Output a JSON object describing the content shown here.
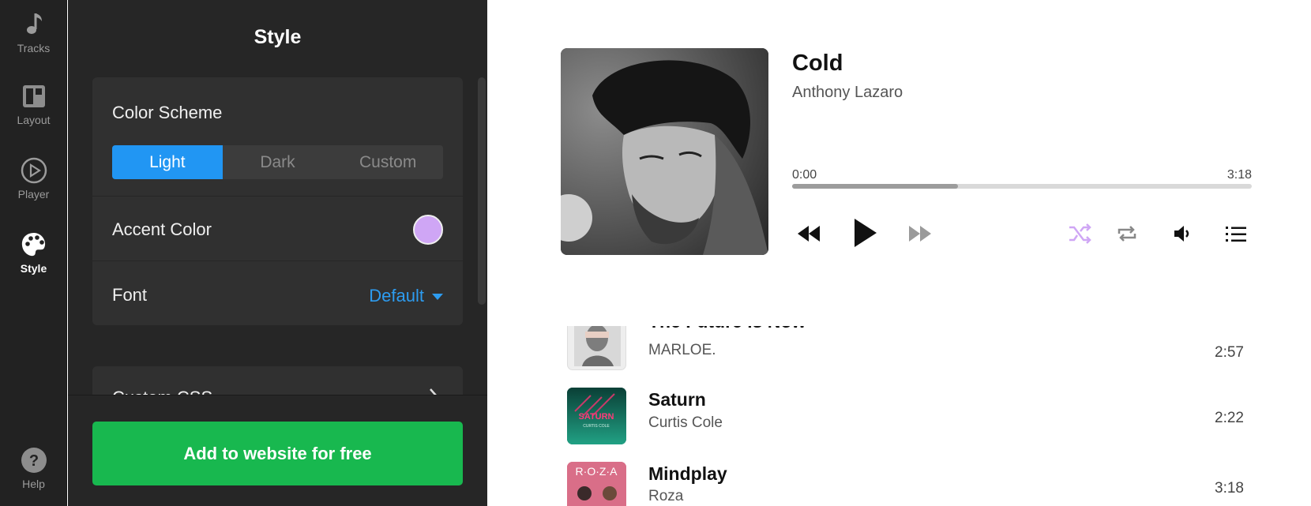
{
  "rail": {
    "items": [
      {
        "label": "Tracks",
        "icon": "music-note-icon"
      },
      {
        "label": "Layout",
        "icon": "layout-icon"
      },
      {
        "label": "Player",
        "icon": "play-circle-icon"
      },
      {
        "label": "Style",
        "icon": "palette-icon",
        "active": true
      },
      {
        "label": "Help",
        "icon": "help-icon"
      }
    ]
  },
  "panel": {
    "title": "Style",
    "color_scheme": {
      "label": "Color Scheme",
      "options": [
        "Light",
        "Dark",
        "Custom"
      ],
      "selected": "Light"
    },
    "accent": {
      "label": "Accent Color",
      "color": "#cfa6f5"
    },
    "font": {
      "label": "Font",
      "value": "Default"
    },
    "custom_css": {
      "label": "Custom CSS"
    },
    "cta_label": "Add to website for free"
  },
  "player": {
    "now_playing": {
      "title": "Cold",
      "artist": "Anthony Lazaro",
      "elapsed": "0:00",
      "duration": "3:18",
      "progress": 0.36
    },
    "tracks": [
      {
        "title": "The Future is Now",
        "artist": "MARLOE.",
        "duration": "2:57"
      },
      {
        "title": "Saturn",
        "artist": "Curtis Cole",
        "duration": "2:22",
        "cover_text": "SATURN",
        "cover_sub": "CURTIS COLE"
      },
      {
        "title": "Mindplay",
        "artist": "Roza",
        "duration": "3:18",
        "cover_text": "R·O·Z·A"
      }
    ]
  },
  "colors": {
    "accent_blue": "#2196f3",
    "cta_green": "#18b84f",
    "shuffle_active": "#cfa6f5"
  }
}
